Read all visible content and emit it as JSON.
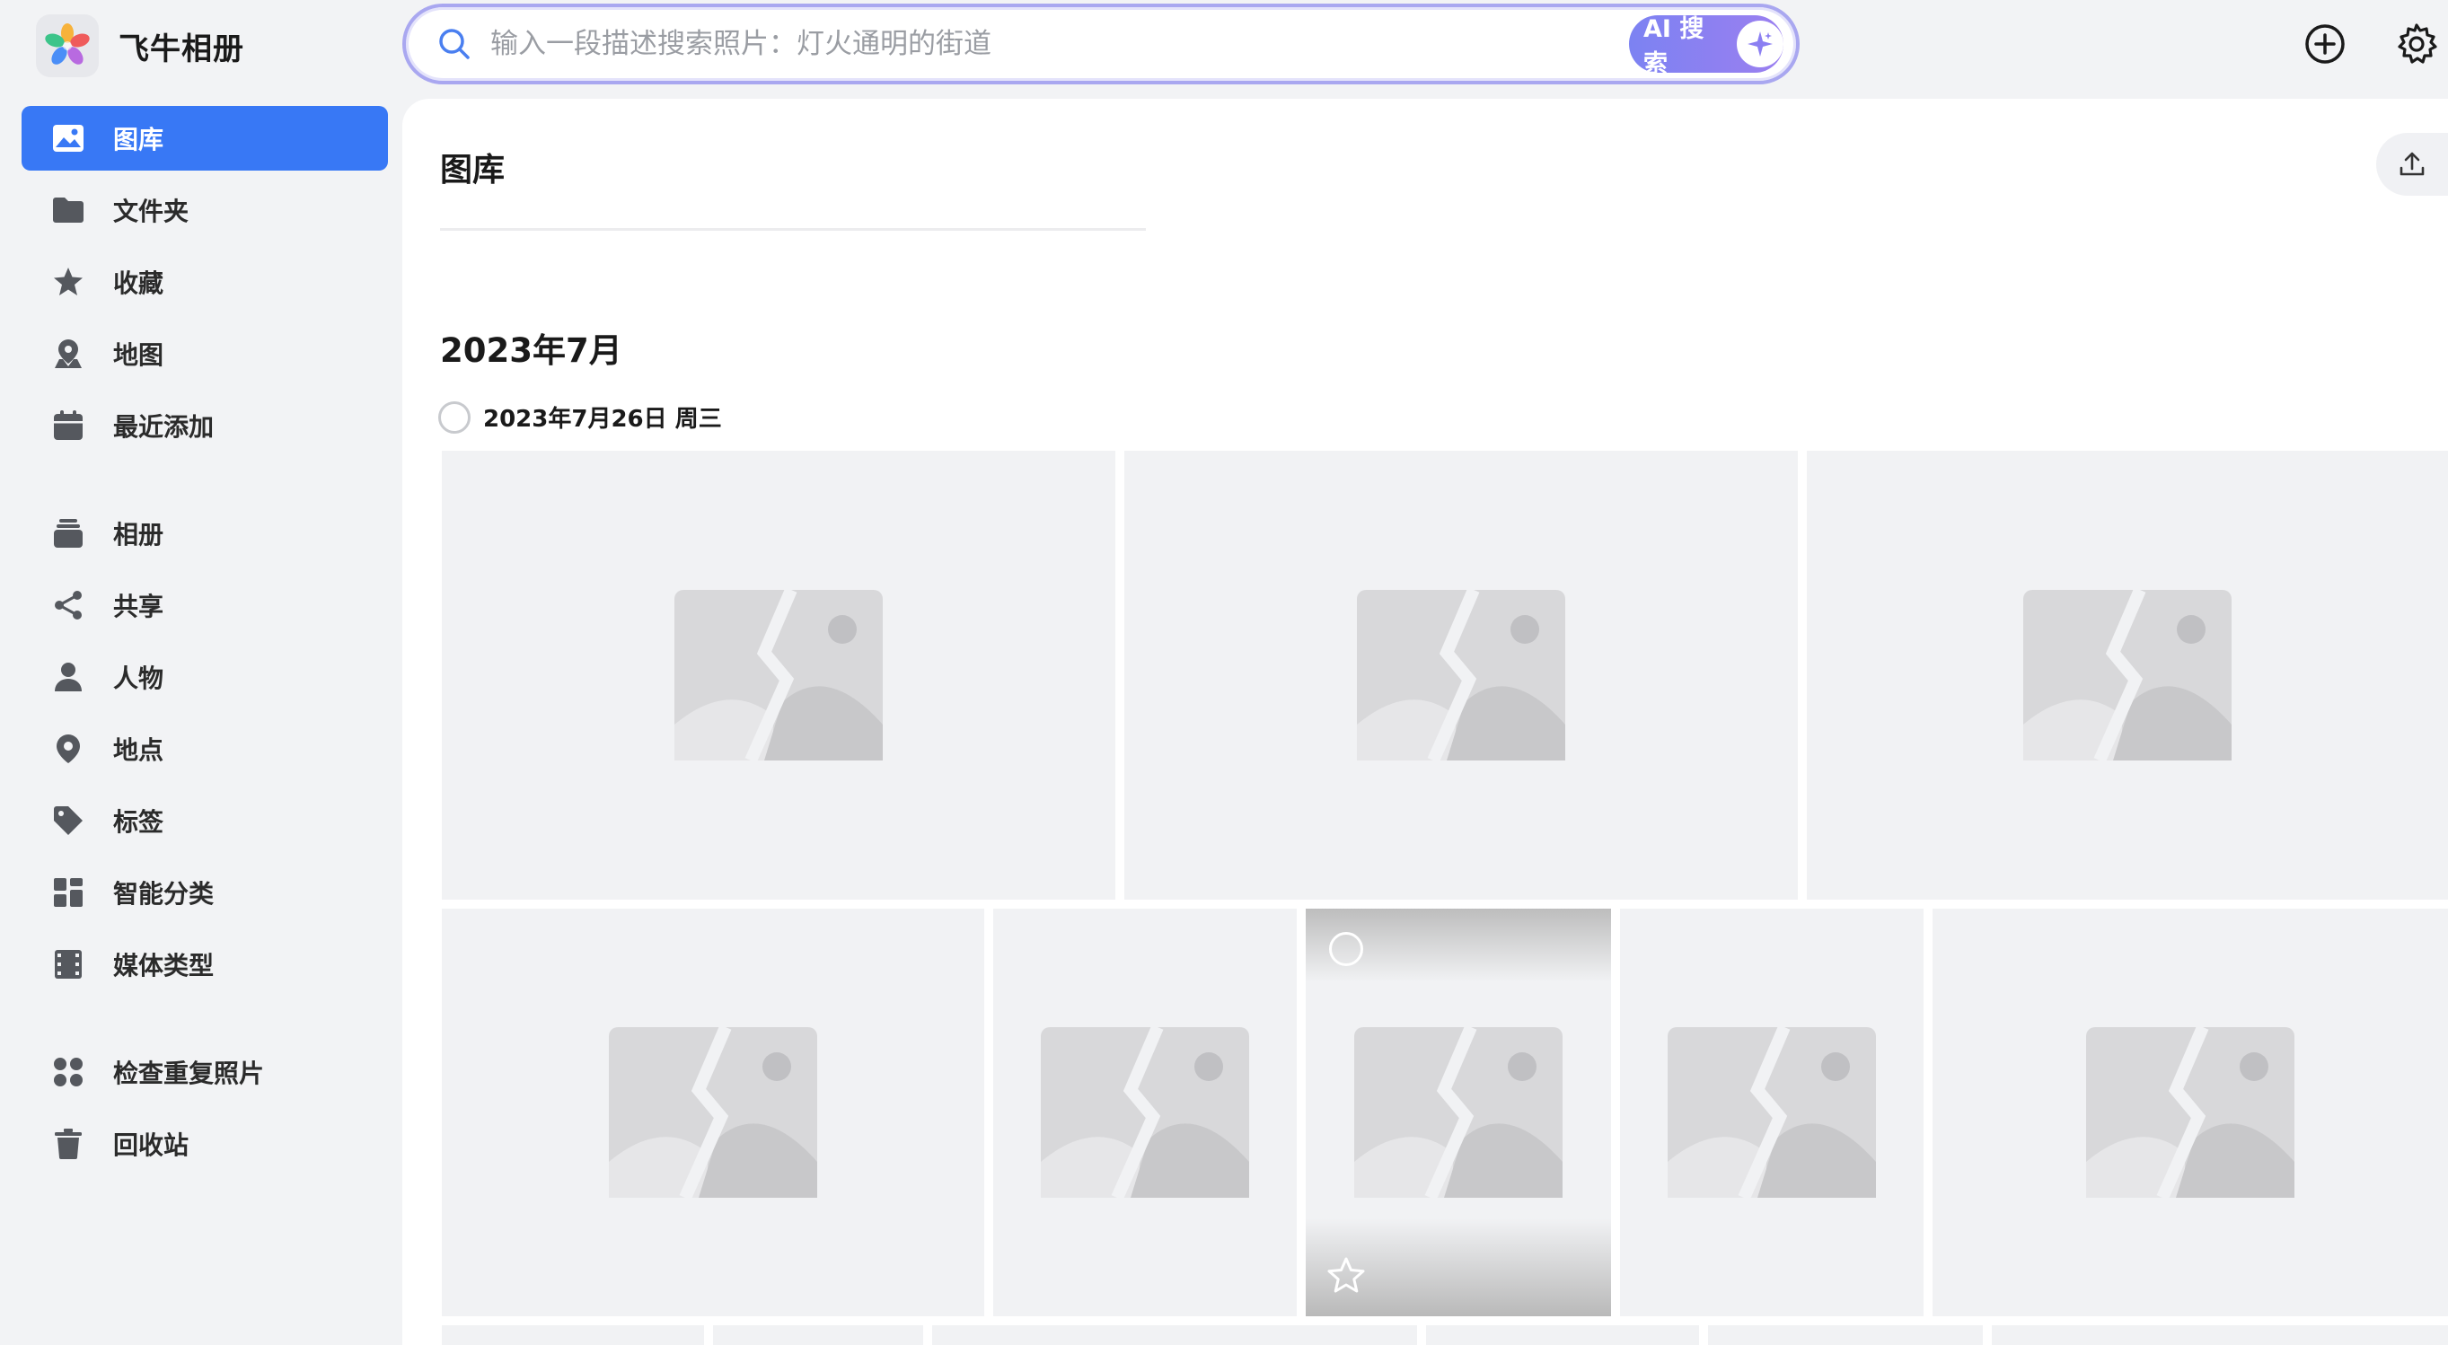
{
  "app": {
    "title": "飞牛相册"
  },
  "search": {
    "placeholder": "输入一段描述搜索照片：灯火通明的街道",
    "ai_button_label": "AI 搜索"
  },
  "sidebar": {
    "items": [
      {
        "label": "图库",
        "icon": "image-icon",
        "active": true
      },
      {
        "label": "文件夹",
        "icon": "folder-icon"
      },
      {
        "label": "收藏",
        "icon": "star-icon"
      },
      {
        "label": "地图",
        "icon": "map-pin-icon"
      },
      {
        "label": "最近添加",
        "icon": "calendar-icon"
      },
      {
        "label": "相册",
        "icon": "album-icon"
      },
      {
        "label": "共享",
        "icon": "share-icon"
      },
      {
        "label": "人物",
        "icon": "person-icon"
      },
      {
        "label": "地点",
        "icon": "location-icon"
      },
      {
        "label": "标签",
        "icon": "tag-icon"
      },
      {
        "label": "智能分类",
        "icon": "grid-icon"
      },
      {
        "label": "媒体类型",
        "icon": "film-icon"
      },
      {
        "label": "检查重复照片",
        "icon": "duplicate-icon"
      },
      {
        "label": "回收站",
        "icon": "trash-icon"
      }
    ]
  },
  "main": {
    "title": "图库",
    "groups": [
      {
        "month": "2023年7月",
        "days": [
          {
            "label": "2023年7月26日 周三"
          }
        ]
      }
    ]
  },
  "colors": {
    "accent": "#3878f5",
    "ai_gradient_start": "#7c82f2",
    "ai_gradient_end": "#9b7ff0",
    "placeholder_bg": "#f1f2f4"
  }
}
